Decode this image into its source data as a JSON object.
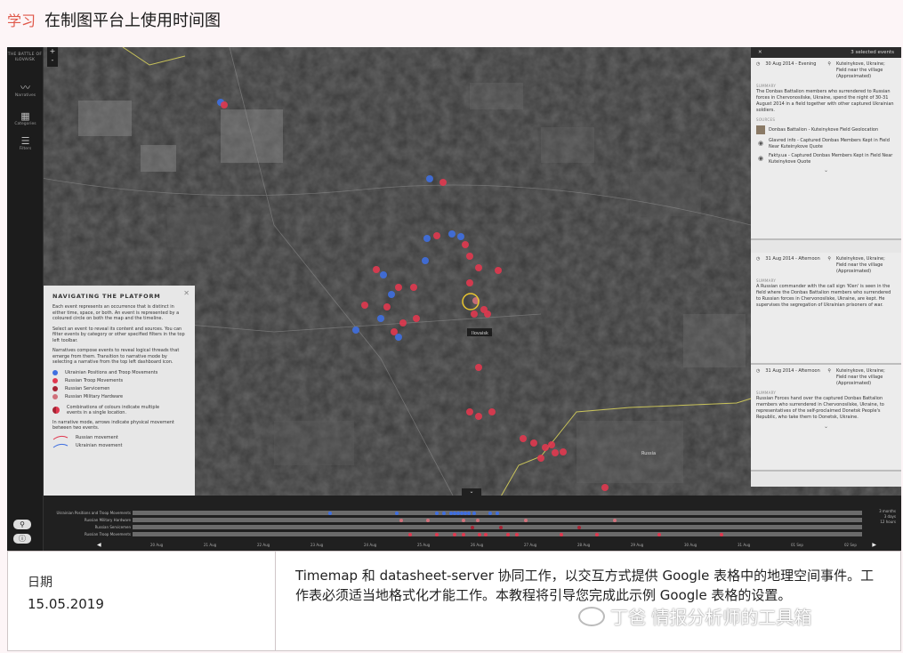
{
  "header": {
    "crumb": "学习",
    "title": "在制图平台上使用时间图"
  },
  "app": {
    "brand": "THE BATTLE OF\nILOVAISK",
    "nav": [
      {
        "label": "Narratives",
        "icon": "chart-line-icon"
      },
      {
        "label": "Categories",
        "icon": "grid-icon"
      },
      {
        "label": "Filters",
        "icon": "filter-icon"
      }
    ],
    "zoom_in": "+",
    "zoom_out": "-",
    "map_labels": [
      "Ilovaisk",
      "Russia"
    ]
  },
  "panel": {
    "close": "✕",
    "count": "3 selected events",
    "cards": [
      {
        "date": "30 Aug 2014 - Evening",
        "place": "Kuteinykove, Ukraine; Field near the village (Approximated)",
        "summary_h": "SUMMARY",
        "summary": "The Donbas Battalion members who surrendered to Russian forces in Chervonosilske, Ukraine, spend the night of 30-31 August 2014 in a field together with other captured Ukrainian soldiers.",
        "sources_h": "SOURCES",
        "sources": [
          "Donbas Battalion - Kuteinykove Field Geolocation",
          "Glavred info - Captured Donbas Members Kept in Field Near Kuteinykove Quote",
          "Fakty.ua - Captured Donbas Members Kept in Field Near Kuteinykove Quote"
        ]
      },
      {
        "date": "31 Aug 2014 - Afternoon",
        "place": "Kuteinykove, Ukraine; Field near the village (Approximated)",
        "summary_h": "SUMMARY",
        "summary": "A Russian commander with the call sign 'Klen' is seen in the field where the Donbas Battalion members who surrendered to Russian forces in Chervonosilske, Ukraine, are kept. He supervises the segregation of Ukrainian prisoners of war."
      },
      {
        "date": "31 Aug 2014 - Afternoon",
        "place": "Kuteinykove, Ukraine; Field near the village (Approximated)",
        "summary_h": "SUMMARY",
        "summary": "Russian Forces hand over the captured Donbas Battalion members who surrendered in Chervonosilske, Ukraine, to representatives of the self-proclaimed Donetsk People's Republic, who take them to Donetsk, Ukraine."
      }
    ]
  },
  "guide": {
    "title": "NAVIGATING THE PLATFORM",
    "close": "✕",
    "p1": "Each event represents an occurrence that is distinct in either time, space, or both. An event is represented by a coloured circle on both the map and the timeline.",
    "p2": "Select an event to reveal its content and sources. You can filter events by category or other specified filters in the top left toolbar.",
    "p3": "Narratives compose events to reveal logical threads that emerge from them. Transition to narrative mode by selecting a narrative from the top left dashboard icon.",
    "legend": [
      {
        "label": "Ukrainian Positions and Troop Movements",
        "color": "#3f6fe0"
      },
      {
        "label": "Russian Troop Movements",
        "color": "#e0384f"
      },
      {
        "label": "Russian Servicemen",
        "color": "#a52434"
      },
      {
        "label": "Russian Military Hardware",
        "color": "#d0707a"
      }
    ],
    "combo": "Combinations of colours indicate multiple events in a single location.",
    "p4": "In narrative mode, arrows indicate physical movement between two events.",
    "arrows": [
      {
        "label": "Russian movement",
        "color": "#e0384f"
      },
      {
        "label": "Ukrainian movement",
        "color": "#3f6fe0"
      }
    ]
  },
  "timeline": {
    "rows": [
      "Ukrainian Positions and Troop Movements",
      "Russian Military Hardware",
      "Russian Servicemen",
      "Russian Troop Movements"
    ],
    "ticks": [
      "20 Aug",
      "21 Aug",
      "22 Aug",
      "23 Aug",
      "24 Aug",
      "25 Aug",
      "26 Aug",
      "27 Aug",
      "28 Aug",
      "29 Aug",
      "30 Aug",
      "31 Aug",
      "01 Sep",
      "02 Sep"
    ],
    "right_labels": [
      "3 months",
      "3 days",
      "12 hours"
    ]
  },
  "info_table": {
    "label": "日期",
    "date": "15.05.2019",
    "desc": "Timemap 和 datasheet-server 协同工作，以交互方式提供 Google 表格中的地理空间事件。工作表必须适当地格式化才能工作。本教程将引导您完成此示例 Google 表格的设置。"
  },
  "watermark": "丁爸 情报分析师的工具箱"
}
